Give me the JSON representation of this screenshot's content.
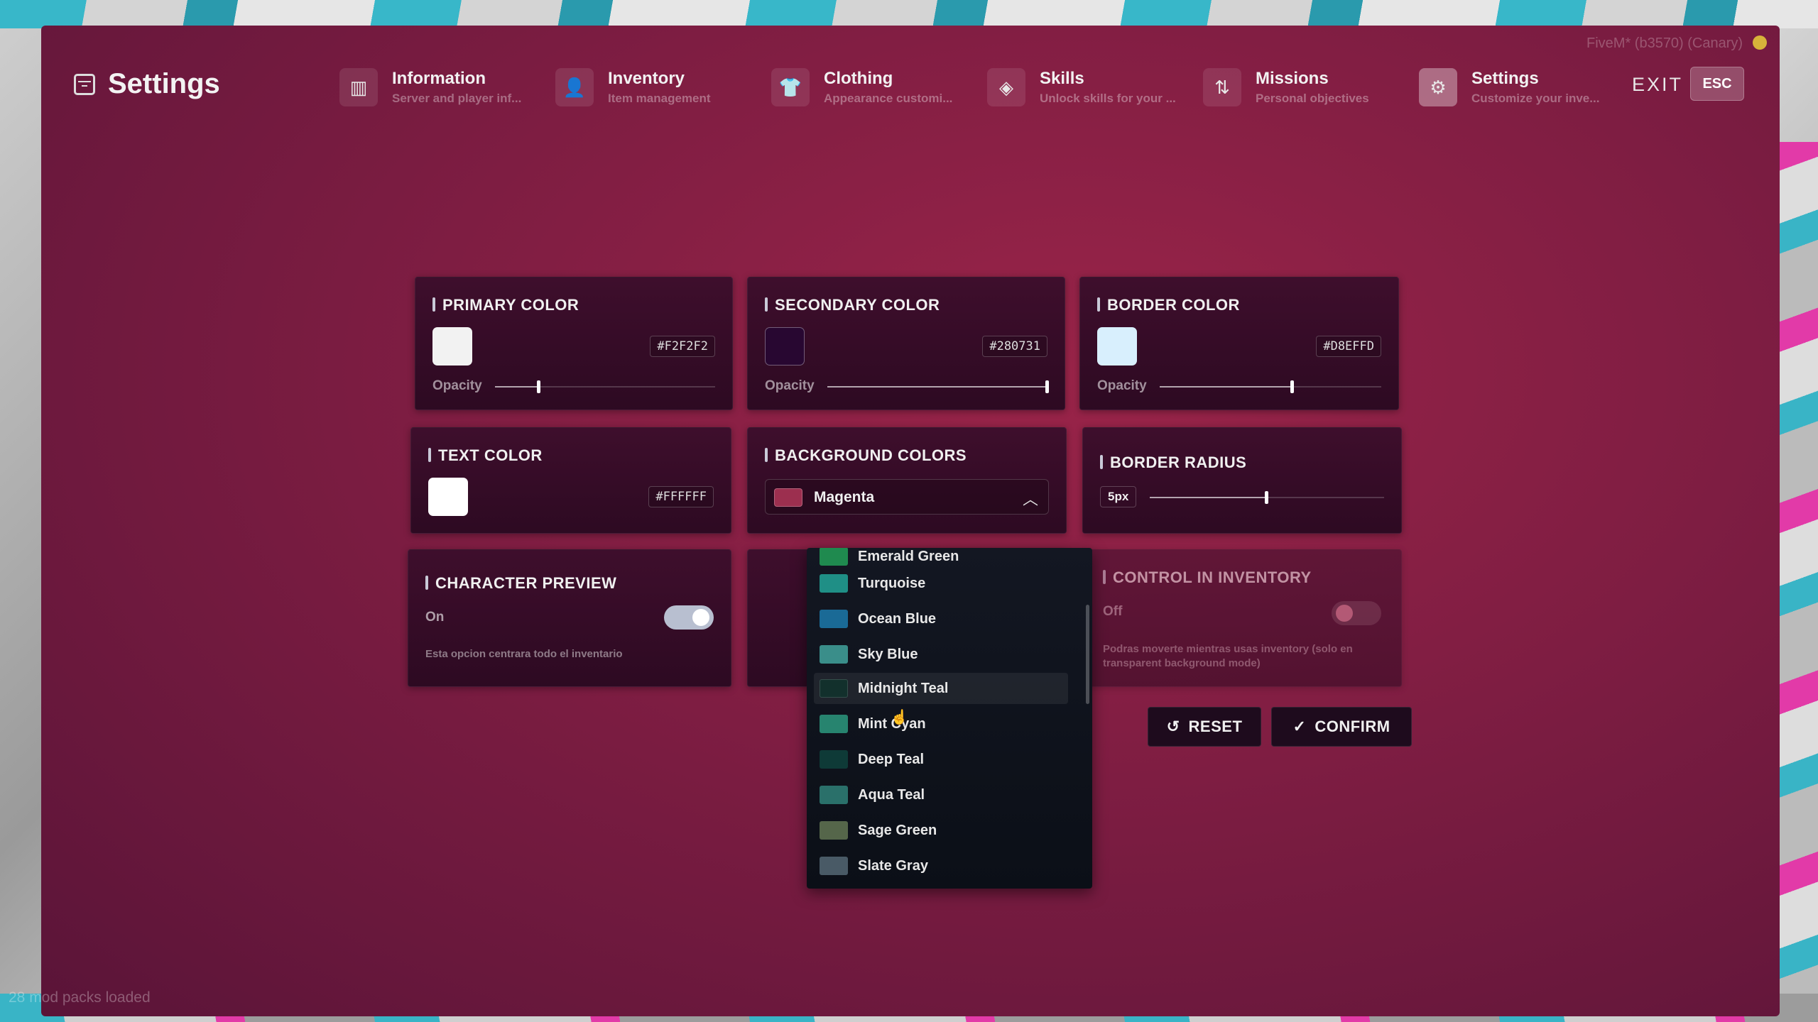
{
  "app": {
    "title": "Settings",
    "build": "FiveM* (b3570) (Canary)",
    "footer": "28 mod packs loaded"
  },
  "tabs": [
    {
      "label": "Information",
      "sub": "Server and player inf...",
      "icon": "map-icon",
      "glyph": "▥"
    },
    {
      "label": "Inventory",
      "sub": "Item management",
      "icon": "user-icon",
      "glyph": "👤"
    },
    {
      "label": "Clothing",
      "sub": "Appearance customi...",
      "icon": "shirt-icon",
      "glyph": "👕"
    },
    {
      "label": "Skills",
      "sub": "Unlock skills for your ...",
      "icon": "layers-icon",
      "glyph": "◈"
    },
    {
      "label": "Missions",
      "sub": "Personal objectives",
      "icon": "git-branch-icon",
      "glyph": "⇅"
    },
    {
      "label": "Settings",
      "sub": "Customize your inve...",
      "icon": "gear-icon",
      "glyph": "⚙"
    }
  ],
  "header": {
    "exit_label": "EXIT",
    "esc_label": "ESC"
  },
  "primary_color": {
    "title": "PRIMARY COLOR",
    "hex": "#F2F2F2",
    "swatch": "#F2F2F2",
    "opacity_label": "Opacity",
    "opacity": 0.2
  },
  "secondary_color": {
    "title": "SECONDARY COLOR",
    "hex": "#280731",
    "swatch": "#280731",
    "opacity_label": "Opacity",
    "opacity": 1.0
  },
  "border_color": {
    "title": "BORDER COLOR",
    "hex": "#D8EFFD",
    "swatch": "#D8EFFD",
    "opacity_label": "Opacity",
    "opacity": 0.6
  },
  "text_color": {
    "title": "TEXT COLOR",
    "hex": "#FFFFFF",
    "swatch": "#FFFFFF"
  },
  "background_colors": {
    "title": "BACKGROUND COLORS",
    "selected": "Magenta",
    "selected_swatch": "#9c2f4f",
    "options": [
      {
        "label": "Emerald Green",
        "swatch": "#1f8a4f"
      },
      {
        "label": "Turquoise",
        "swatch": "#1f8f86"
      },
      {
        "label": "Ocean Blue",
        "swatch": "#1a6a96"
      },
      {
        "label": "Sky Blue",
        "swatch": "#3a8e8a"
      },
      {
        "label": "Midnight Teal",
        "swatch": "#12302c"
      },
      {
        "label": "Mint Cyan",
        "swatch": "#27846f"
      },
      {
        "label": "Deep Teal",
        "swatch": "#0e3a37"
      },
      {
        "label": "Aqua Teal",
        "swatch": "#2a706a"
      },
      {
        "label": "Sage Green",
        "swatch": "#55664a"
      },
      {
        "label": "Slate Gray",
        "swatch": "#495a66"
      }
    ]
  },
  "border_radius": {
    "title": "BORDER RADIUS",
    "value": "5px",
    "level": 0.5
  },
  "character_preview": {
    "title": "CHARACTER PREVIEW",
    "state": "On",
    "enabled": true,
    "desc": "Esta opcion centrara todo el inventario"
  },
  "control_inventory": {
    "title": "CONTROL IN INVENTORY",
    "state": "Off",
    "enabled": false,
    "desc": "Podras moverte mientras usas inventory (solo en transparent background mode)"
  },
  "buttons": {
    "reset": "RESET",
    "confirm": "CONFIRM"
  },
  "colors": {
    "accent": "#9c2f4f",
    "card_bg": "#3a0d29",
    "toggle_on": "#b8bfd0",
    "toggle_off": "#d98a9e"
  }
}
